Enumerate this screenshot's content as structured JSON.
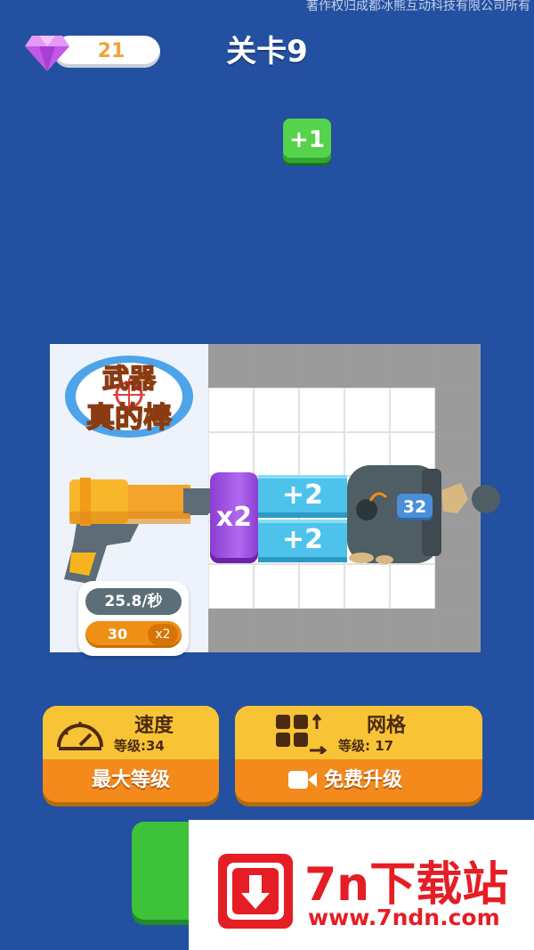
{
  "header": {
    "copyright": "著作权归成都冰熊互动科技有限公司所有",
    "gem_count": "21",
    "level_title": "关卡9",
    "gem_icon": "diamond-icon"
  },
  "floating": {
    "bonus_text": "+1"
  },
  "weapon_panel": {
    "logo_lines": [
      "武器",
      "真的棒"
    ],
    "fire_rate": "25.8/秒",
    "multiplier_value": "30",
    "multiplier_label": "x2"
  },
  "board": {
    "x2_block": "x2",
    "plus_blocks": [
      "+2",
      "+2"
    ],
    "cannon_ammo": "32"
  },
  "upgrades": {
    "speed": {
      "title": "速度",
      "level": "等级:34",
      "action": "最大等级",
      "icon": "speedometer-icon"
    },
    "grid": {
      "title": "网格",
      "level": "等级: 17",
      "action": "免费升级",
      "icon": "grid-expand-icon",
      "action_icon": "video-icon"
    }
  },
  "watermark": {
    "title": "7n下载站",
    "url": "www.7ndn.com",
    "icon": "download-arrow-icon"
  },
  "colors": {
    "background": "#2350a0",
    "accent_orange": "#f38a1b",
    "accent_green": "#3dc23a",
    "watermark_red": "#e51e25"
  }
}
